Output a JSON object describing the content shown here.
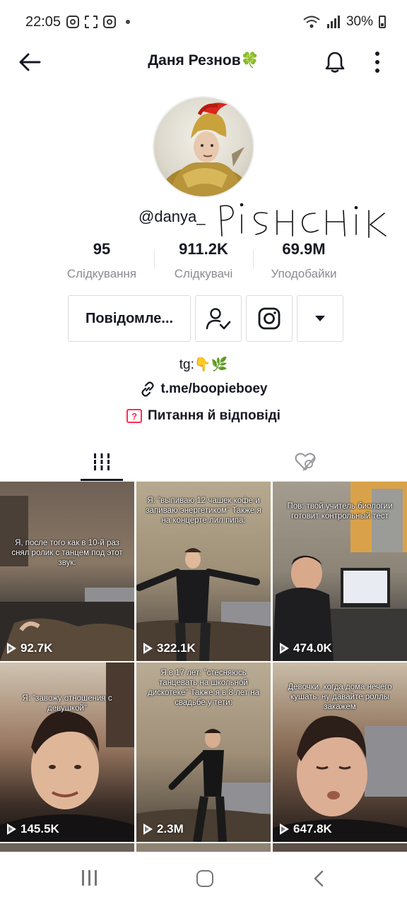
{
  "status_bar": {
    "time": "22:05",
    "battery": "30%",
    "left_icons": [
      "instagram-icon",
      "scan-icon",
      "instagram-icon",
      "dot-icon"
    ],
    "right_icons": [
      "wifi-icon",
      "signal-icon",
      "battery-icon"
    ]
  },
  "header": {
    "title": "Даня Резнов🍀",
    "back_icon": "back-arrow-icon",
    "bell_icon": "bell-icon",
    "more_icon": "more-vertical-icon"
  },
  "profile": {
    "username": "@danya_",
    "handwritten_overlay": "PISHCHIK",
    "stats": [
      {
        "value": "95",
        "label": "Слідкування"
      },
      {
        "value": "911.2K",
        "label": "Слідкувачі"
      },
      {
        "value": "69.9M",
        "label": "Уподобайки"
      }
    ],
    "buttons": {
      "message": "Повідомле...",
      "follow_icon": "person-check-icon",
      "instagram_icon": "instagram-icon",
      "dropdown_icon": "caret-down-icon"
    },
    "bio": "tg:👇🌿",
    "link": "t.me/boopieboey",
    "qa": "Питання й відповіді"
  },
  "tabs": [
    {
      "name": "videos",
      "icon": "grid-bars-icon",
      "active": true
    },
    {
      "name": "liked",
      "icon": "hidden-heart-icon",
      "active": false
    }
  ],
  "videos": [
    {
      "caption": "Я, после того как в 10-й раз снял ролик с танцем под этот звук:",
      "views": "92.7K"
    },
    {
      "caption": "Я: \"выпиваю 12 чашек кофе и запиваю энергетиком\" Также я на концерте лил пипа:",
      "views": "322.1K"
    },
    {
      "caption": "Пов: твой учитель биологии готовит контрольный тест",
      "views": "474.0K"
    },
    {
      "caption": "Я: \"завожу отношения с девушкой\"",
      "views": "145.5K"
    },
    {
      "caption": "Я в 17 лет: \"стесняюсь танцевать на школьной дискотеке\" Также я в 8 лет на свадьбе у тети:",
      "views": "2.3M"
    },
    {
      "caption": "Девочки, когда дома нечего кушать: ну давайте роллы закажем",
      "views": "647.8K"
    }
  ],
  "navbar": {
    "recents_icon": "recents-icon",
    "home_icon": "home-icon",
    "back_icon": "nav-back-icon"
  },
  "colors": {
    "accent": "#fe2c55",
    "text": "#161823",
    "muted": "#8a8b91"
  }
}
